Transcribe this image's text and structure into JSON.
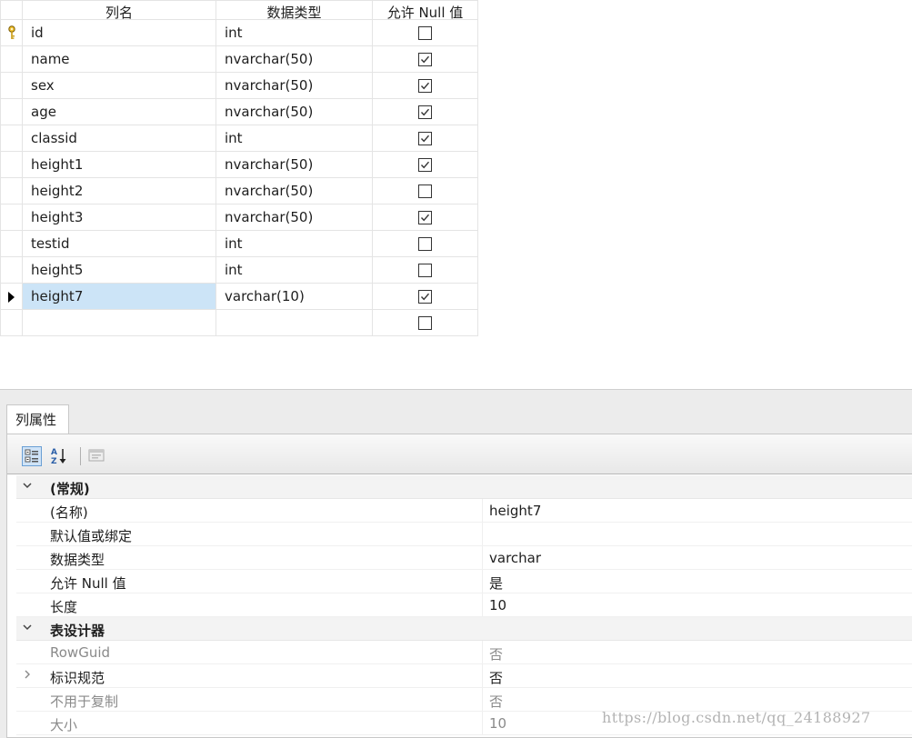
{
  "grid": {
    "headers": {
      "name": "列名",
      "type": "数据类型",
      "nullable": "允许 Null 值"
    },
    "rows": [
      {
        "name": "id",
        "type": "int",
        "nullable": false,
        "primary_key": true
      },
      {
        "name": "name",
        "type": "nvarchar(50)",
        "nullable": true
      },
      {
        "name": "sex",
        "type": "nvarchar(50)",
        "nullable": true
      },
      {
        "name": "age",
        "type": "nvarchar(50)",
        "nullable": true
      },
      {
        "name": "classid",
        "type": "int",
        "nullable": true
      },
      {
        "name": "height1",
        "type": "nvarchar(50)",
        "nullable": true
      },
      {
        "name": "height2",
        "type": "nvarchar(50)",
        "nullable": false
      },
      {
        "name": "height3",
        "type": "nvarchar(50)",
        "nullable": true
      },
      {
        "name": "testid",
        "type": "int",
        "nullable": false
      },
      {
        "name": "height5",
        "type": "int",
        "nullable": false
      },
      {
        "name": "height7",
        "type": "varchar(10)",
        "nullable": true,
        "current": true
      },
      {
        "name": "",
        "type": "",
        "nullable": false
      }
    ]
  },
  "properties": {
    "tab_label": "列属性",
    "toolbar": {
      "categorized_icon": "categorized-view-icon",
      "alphabetical_icon": "sort-az-icon",
      "pages_icon": "property-pages-icon"
    },
    "rows": [
      {
        "kind": "category",
        "name": "(常规)",
        "expanded": true
      },
      {
        "kind": "prop",
        "name": "(名称)",
        "value": "height7"
      },
      {
        "kind": "prop",
        "name": "默认值或绑定",
        "value": ""
      },
      {
        "kind": "prop",
        "name": "数据类型",
        "value": "varchar"
      },
      {
        "kind": "prop",
        "name": "允许 Null 值",
        "value": "是"
      },
      {
        "kind": "prop",
        "name": "长度",
        "value": "10"
      },
      {
        "kind": "category",
        "name": "表设计器",
        "expanded": true
      },
      {
        "kind": "prop",
        "name": "RowGuid",
        "value": "否",
        "disabled": true
      },
      {
        "kind": "prop",
        "name": "标识规范",
        "value": "否",
        "expandable": true
      },
      {
        "kind": "prop",
        "name": "不用于复制",
        "value": "否",
        "disabled": true
      },
      {
        "kind": "prop",
        "name": "大小",
        "value": "10",
        "disabled": true
      }
    ]
  },
  "watermark": "https://blog.csdn.net/qq_24188927"
}
